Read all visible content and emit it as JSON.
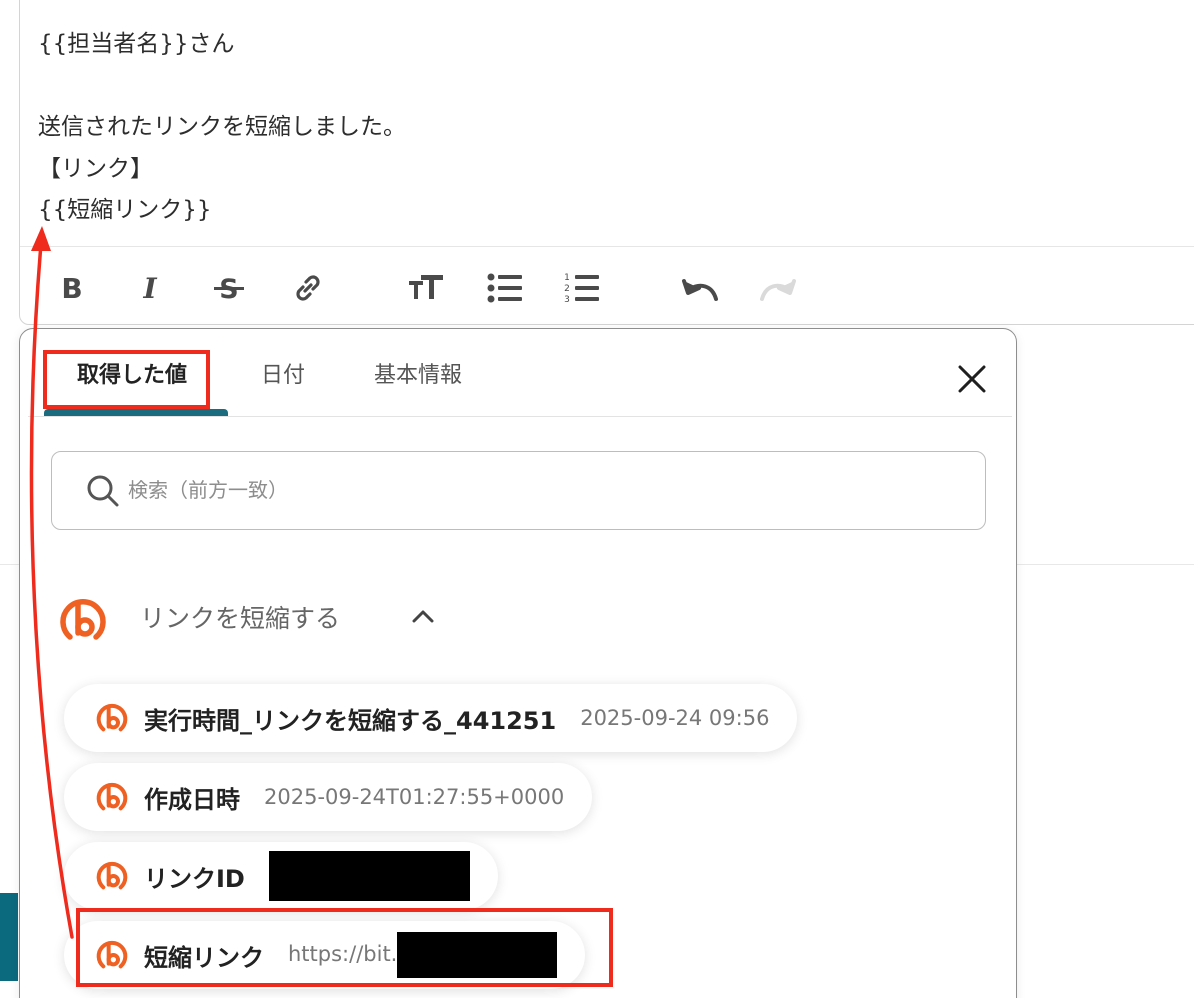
{
  "editor": {
    "lines": [
      "{{担当者名}}さん",
      "",
      "送信されたリンクを短縮しました。",
      "【リンク】",
      "{{短縮リンク}}"
    ],
    "toolbar": [
      {
        "name": "bold-icon",
        "label": "B"
      },
      {
        "name": "italic-icon",
        "label": "I"
      },
      {
        "name": "strikethrough-icon",
        "label": "S"
      },
      {
        "name": "link-icon"
      },
      {
        "name": "text-size-icon"
      },
      {
        "name": "bulleted-list-icon"
      },
      {
        "name": "numbered-list-icon"
      },
      {
        "name": "undo-icon"
      },
      {
        "name": "redo-icon"
      }
    ]
  },
  "panel": {
    "tabs": [
      {
        "label": "取得した値",
        "active": true
      },
      {
        "label": "日付",
        "active": false
      },
      {
        "label": "基本情報",
        "active": false
      }
    ],
    "search": {
      "placeholder": "検索（前方一致）",
      "value": ""
    },
    "group": {
      "title": "リンクを短縮する",
      "expanded": true
    },
    "items": [
      {
        "label": "実行時間_リンクを短縮する_441251",
        "value": "2025-09-24 09:56"
      },
      {
        "label": "作成日時",
        "value": "2025-09-24T01:27:55+0000"
      },
      {
        "label": "リンクID",
        "value": "",
        "redacted": true
      },
      {
        "label": "短縮リンク",
        "value": "https://bit.",
        "redacted": true
      }
    ]
  },
  "colors": {
    "accent": "#1c6c80",
    "bitly_orange": "#ee6123",
    "annotation_red": "#ee2b1d"
  }
}
